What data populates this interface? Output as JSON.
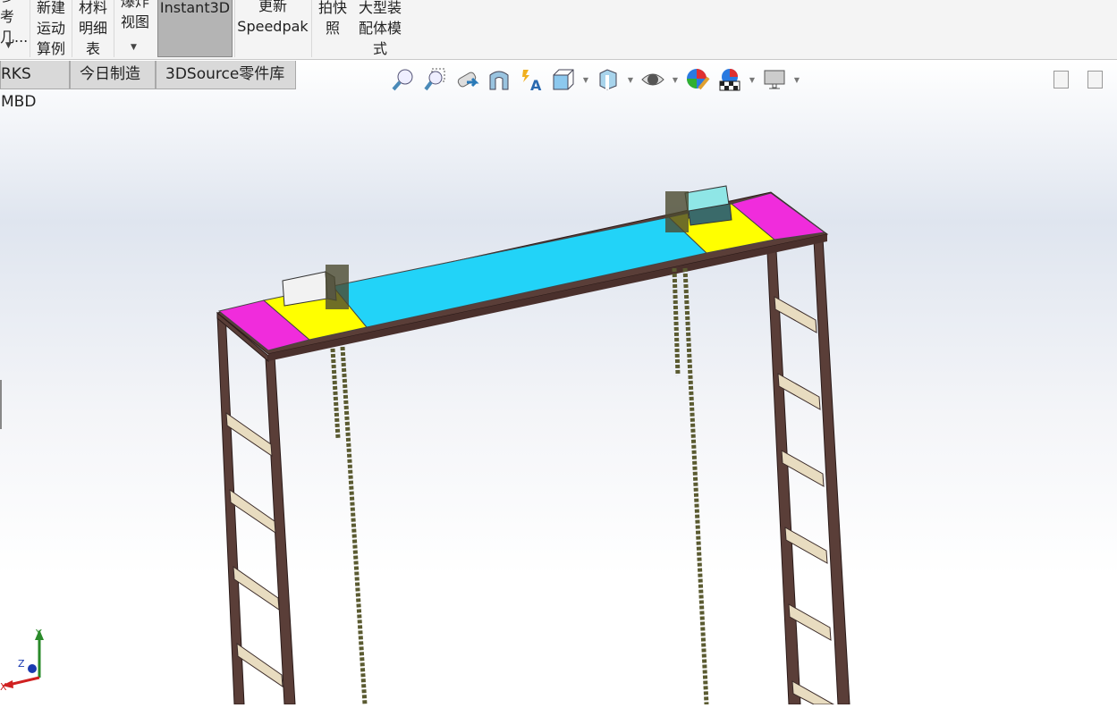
{
  "ribbon": {
    "items": [
      {
        "label": "参考\n几..."
      },
      {
        "label": "新建\n运动\n算例"
      },
      {
        "label": "材料\n明细\n表"
      },
      {
        "label": "爆炸\n视图"
      },
      {
        "label": "Instant3D"
      },
      {
        "label": "更新\nSpeedpak"
      },
      {
        "label": "拍快\n照"
      },
      {
        "label": "大型装\n配体模\n式"
      }
    ]
  },
  "tabs": [
    {
      "label": "RKS MBD"
    },
    {
      "label": "今日制造"
    },
    {
      "label": "3DSource零件库"
    }
  ],
  "view_toolbar": [
    "zoom-to-fit-icon",
    "zoom-to-area-icon",
    "previous-view-icon",
    "section-view-icon",
    "dynamic-annotation-icon",
    "view-orientation-icon",
    "display-style-icon",
    "hide-show-icon",
    "edit-appearance-icon",
    "apply-scene-icon",
    "view-settings-icon"
  ],
  "triad": {
    "x": "X",
    "y": "Y",
    "z": "Z"
  },
  "colors": {
    "top_plate": "#22d3f8",
    "end_plate": "#f02cdc",
    "mount_plate": "#ffff00",
    "frame": "#5a3e38",
    "rungs": "#e8dcc0"
  }
}
